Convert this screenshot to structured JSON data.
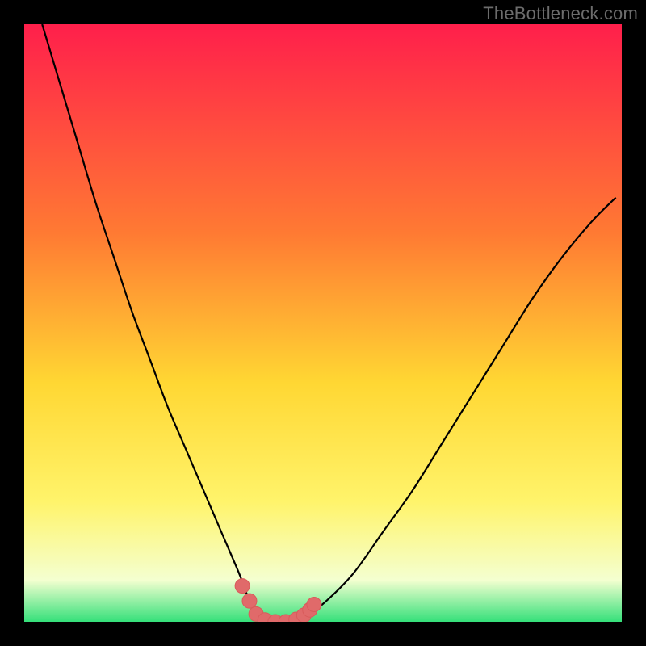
{
  "watermark": "TheBottleneck.com",
  "colors": {
    "bg": "#000000",
    "grad_top": "#ff1f4b",
    "grad_mid1": "#ff7a33",
    "grad_mid2": "#ffd733",
    "grad_low1": "#fff46b",
    "grad_low2": "#f4ffd0",
    "grad_bottom": "#35e07a",
    "curve": "#000000",
    "marker_fill": "#e06a6a",
    "marker_stroke": "#d95b5b"
  },
  "chart_data": {
    "type": "line",
    "title": "",
    "xlabel": "",
    "ylabel": "",
    "xlim": [
      0,
      100
    ],
    "ylim": [
      0,
      100
    ],
    "series": [
      {
        "name": "bottleneck-curve",
        "x": [
          3,
          6,
          9,
          12,
          15,
          18,
          21,
          24,
          27,
          30,
          33,
          36,
          37.5,
          39,
          41,
          43,
          45,
          47,
          50,
          55,
          60,
          65,
          70,
          75,
          80,
          85,
          90,
          95,
          99
        ],
        "y": [
          100,
          90,
          80,
          70,
          61,
          52,
          44,
          36,
          29,
          22,
          15,
          8,
          4,
          1,
          0,
          0,
          0,
          1,
          3,
          8,
          15,
          22,
          30,
          38,
          46,
          54,
          61,
          67,
          71
        ]
      }
    ],
    "markers": {
      "name": "highlight-dots",
      "x": [
        36.5,
        37.7,
        38.8,
        40.3,
        42.0,
        43.8,
        45.5,
        46.8,
        47.8,
        48.5
      ],
      "y": [
        6.0,
        3.5,
        1.3,
        0.3,
        0.0,
        0.0,
        0.4,
        1.1,
        2.0,
        2.9
      ]
    },
    "gradient_stops": [
      {
        "offset": 0.0,
        "key": "grad_top"
      },
      {
        "offset": 0.35,
        "key": "grad_mid1"
      },
      {
        "offset": 0.6,
        "key": "grad_mid2"
      },
      {
        "offset": 0.8,
        "key": "grad_low1"
      },
      {
        "offset": 0.93,
        "key": "grad_low2"
      },
      {
        "offset": 1.0,
        "key": "grad_bottom"
      }
    ]
  }
}
